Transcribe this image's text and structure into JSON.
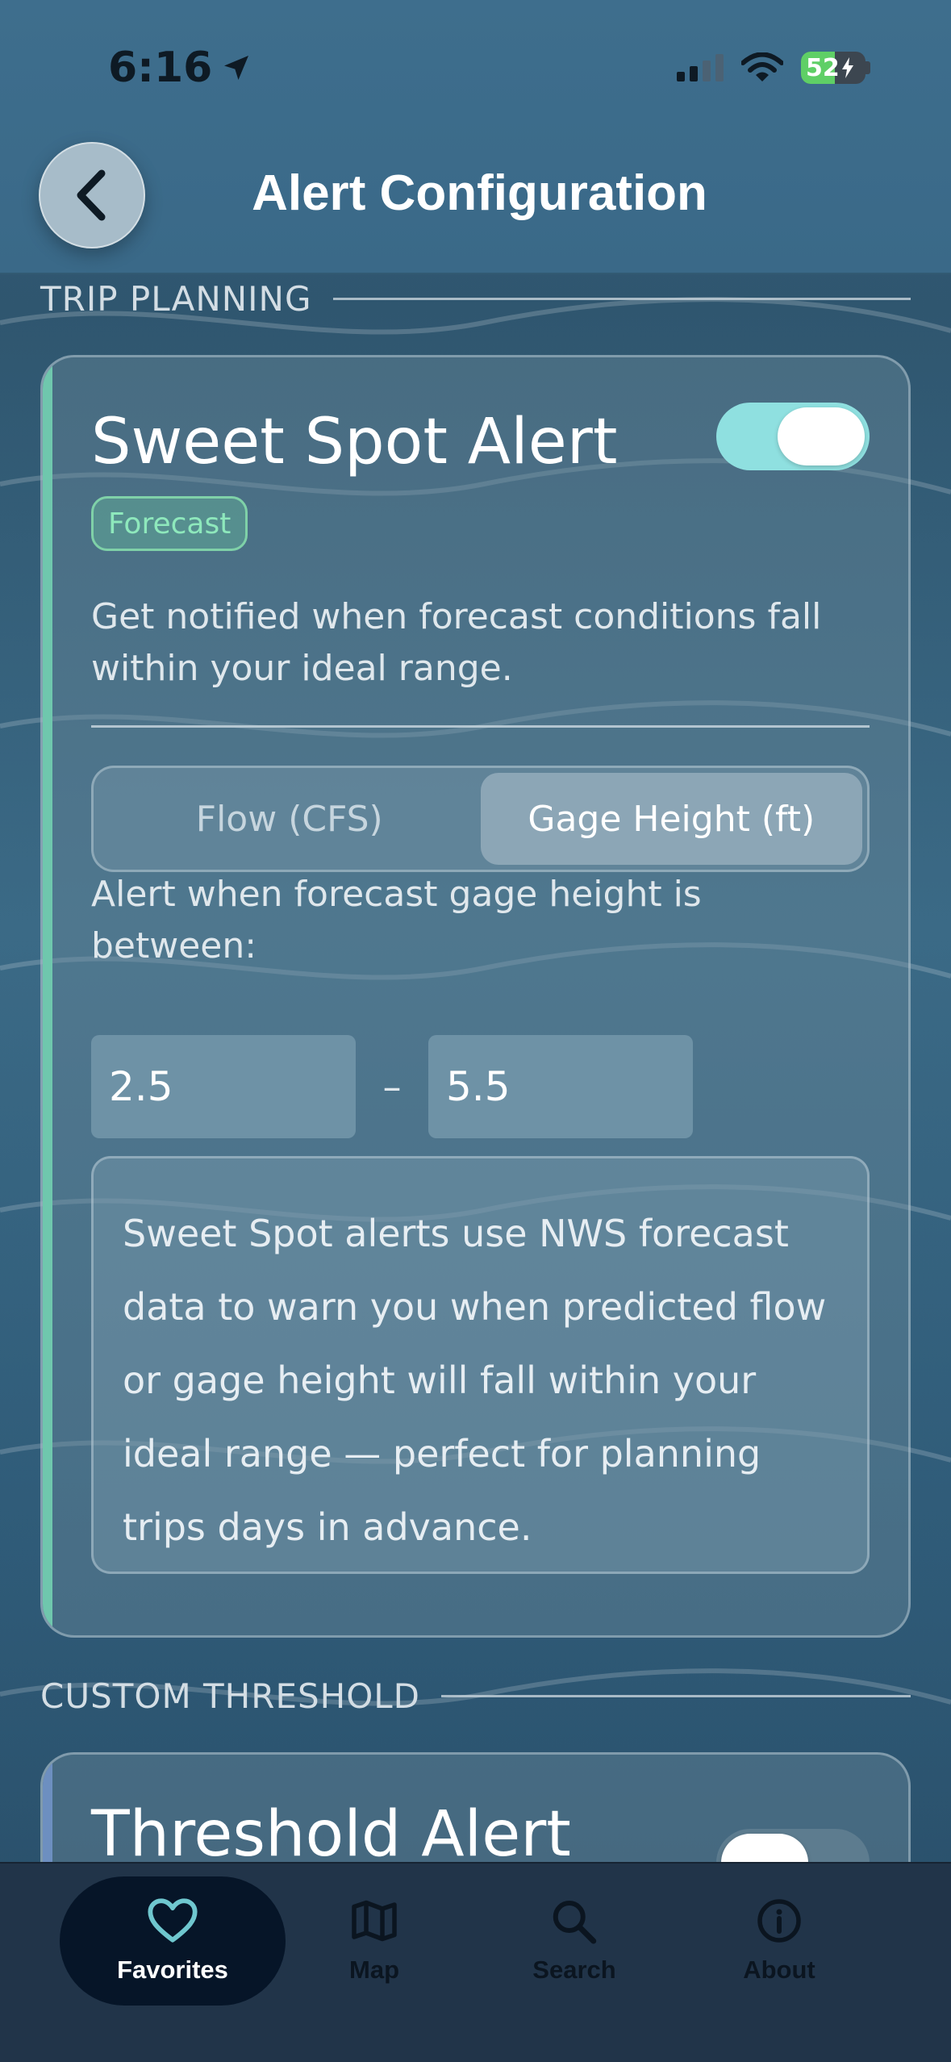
{
  "status_bar": {
    "time": "6:16",
    "battery": "52"
  },
  "header": {
    "title": "Alert Configuration",
    "back_icon": "chevron-left-icon"
  },
  "trip_planning": {
    "section_label": "TRIP PLANNING",
    "card": {
      "title": "Sweet Spot Alert",
      "enabled": true,
      "badge": "Forecast",
      "description": "Get notified when forecast conditions fall within your ideal range.",
      "segments": [
        "Flow (CFS)",
        "Gage Height (ft)"
      ],
      "selected_segment": "Gage Height (ft)",
      "range_label": "Alert when forecast gage height is between:",
      "range_min": "2.5",
      "range_separator": "–",
      "range_max": "5.5",
      "info": "Sweet Spot alerts use NWS forecast data to warn you when predicted flow or gage height will fall within your ideal range — perfect for planning trips days in advance."
    }
  },
  "custom_threshold": {
    "section_label": "CUSTOM THRESHOLD",
    "card": {
      "title": "Threshold Alert",
      "enabled": false
    }
  },
  "tabbar": {
    "tabs": [
      {
        "label": "Favorites",
        "icon": "heart-icon",
        "active": true
      },
      {
        "label": "Map",
        "icon": "map-icon",
        "active": false
      },
      {
        "label": "Search",
        "icon": "search-icon",
        "active": false
      },
      {
        "label": "About",
        "icon": "info-icon",
        "active": false
      }
    ]
  },
  "colors": {
    "accent_green": "#6fc7ad",
    "toggle_on": "#8fe0e0",
    "tabbar_bg": "#213449",
    "active_tab_bg": "#061528"
  }
}
